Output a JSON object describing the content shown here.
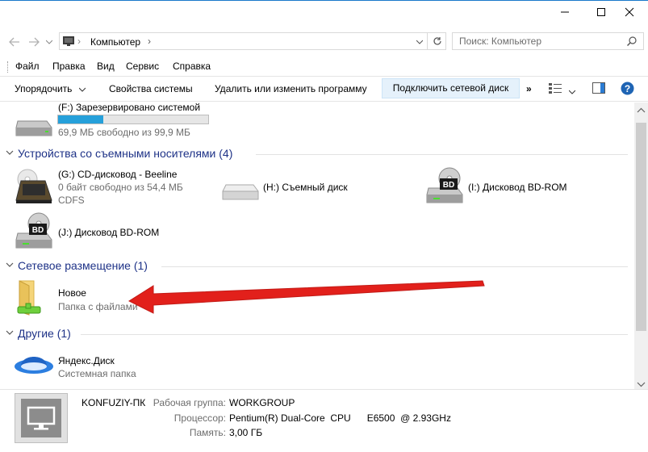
{
  "window": {
    "minimize_icon": "minimize-icon",
    "maximize_icon": "maximize-icon",
    "close_icon": "close-icon"
  },
  "address": {
    "path": "Компьютер",
    "separator": "›",
    "search_placeholder": "Поиск: Компьютер"
  },
  "menu": [
    "Файл",
    "Правка",
    "Вид",
    "Сервис",
    "Справка"
  ],
  "toolbar": {
    "organize": "Упорядочить",
    "system_props": "Свойства системы",
    "uninstall": "Удалить или изменить программу",
    "map_drive": "Подключить сетевой диск",
    "more": "»"
  },
  "drive_f": {
    "name": "(F:) Зарезервировано системой",
    "free": "69,9 МБ свободно из 99,9 МБ",
    "used_fraction": 0.3
  },
  "removable": {
    "header": "Устройства со съемными носителями (4)",
    "g_name": "(G:) CD-дисковод - Beeline",
    "g_free": "0 байт свободно из 54,4 МБ",
    "g_fs": "CDFS",
    "h_name": "(H:) Съемный диск",
    "i_name": "(I:) Дисковод BD-ROM",
    "j_name": "(J:) Дисковод BD-ROM",
    "bd_label": "BD"
  },
  "network": {
    "header": "Сетевое размещение (1)",
    "name": "Новое",
    "sub": "Папка с файлами"
  },
  "other": {
    "header": "Другие (1)",
    "name": "Яндекс.Диск",
    "sub": "Системная папка"
  },
  "details": {
    "computer_name": "KONFUZIY-ПК",
    "workgroup_label": "Рабочая группа:",
    "workgroup": "WORKGROUP",
    "cpu_label": "Процессор:",
    "cpu": "Pentium(R) Dual-Core  CPU      E6500  @ 2.93GHz",
    "ram_label": "Память:",
    "ram": "3,00 ГБ"
  },
  "colors": {
    "accent": "#1979ca",
    "header_text": "#1e3287",
    "progress": "#26a0da",
    "arrow": "#e2201b"
  }
}
